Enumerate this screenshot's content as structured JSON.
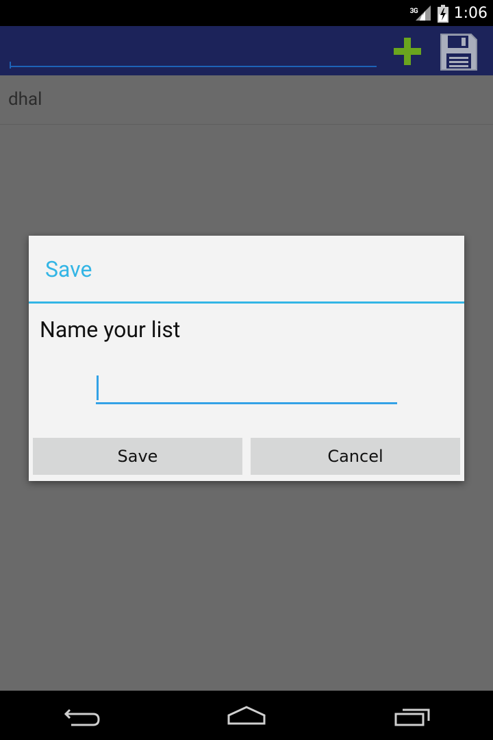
{
  "status_bar": {
    "network_type": "3G",
    "time": "1:06"
  },
  "action_bar": {
    "item_input_value": "",
    "add_icon": "plus-icon",
    "save_icon": "floppy-disk-icon"
  },
  "list": {
    "items": [
      {
        "label": "dhal"
      }
    ]
  },
  "dialog": {
    "title": "Save",
    "message": "Name your list",
    "name_input_value": "",
    "save_label": "Save",
    "cancel_label": "Cancel"
  },
  "nav_bar": {
    "back_icon": "back-icon",
    "home_icon": "home-icon",
    "recent_icon": "recent-apps-icon"
  },
  "colors": {
    "action_bar": "#1c235a",
    "accent": "#33b5e5",
    "add_icon": "#6aa51e",
    "scrim": "#6a6a6a"
  }
}
